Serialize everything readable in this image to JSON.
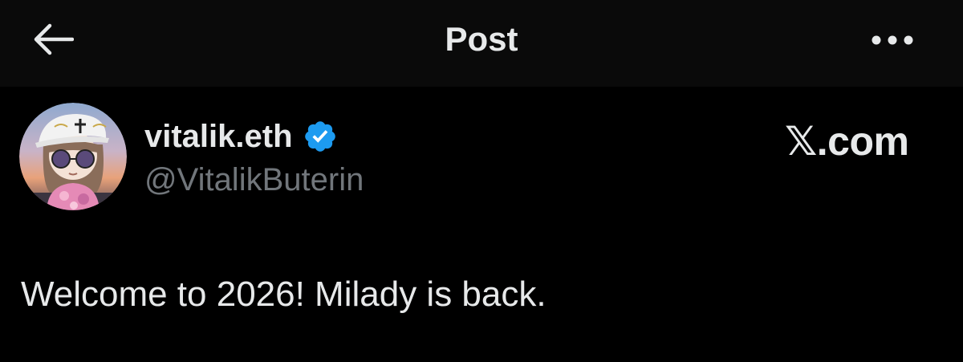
{
  "header": {
    "title": "Post",
    "back_icon": "arrow-left-icon",
    "more_icon": "more-horizontal-icon"
  },
  "author": {
    "display_name": "vitalik.eth",
    "handle": "@VitalikButerin",
    "verified": true,
    "verified_icon": "verified-badge-icon",
    "avatar": "avatar-image"
  },
  "watermark": {
    "text": "𝕏.com"
  },
  "post": {
    "text": "Welcome to 2026! Milady is back."
  },
  "colors": {
    "background": "#000000",
    "header_background": "#0a0a0a",
    "primary_text": "#e7e9ea",
    "secondary_text": "#71767b",
    "verified_blue": "#1d9bf0"
  }
}
